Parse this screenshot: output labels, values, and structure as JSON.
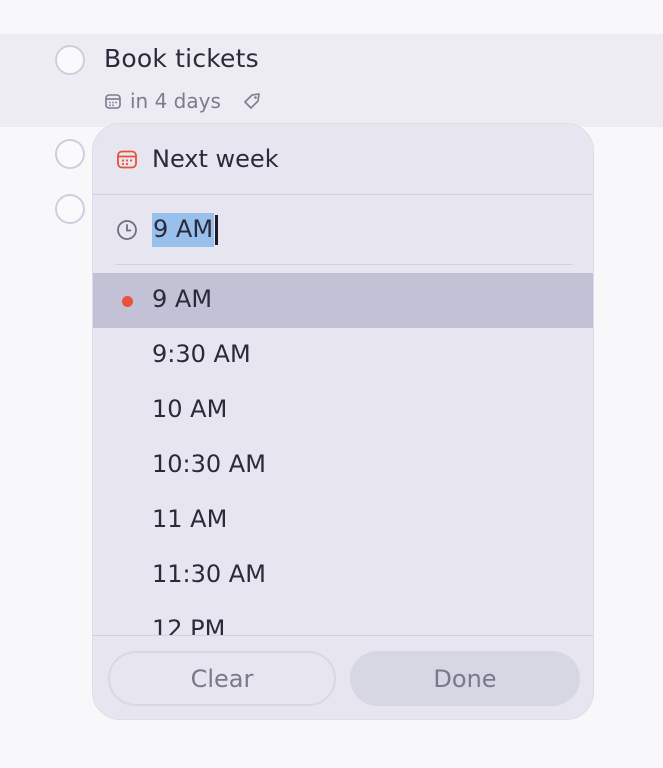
{
  "task": {
    "title": "Book tickets",
    "due": "in 4 days",
    "icons": {
      "due": "calendar-icon",
      "label": "tag-icon"
    }
  },
  "picker": {
    "date_label": "Next week",
    "date_icon": "calendar-icon",
    "date_icon_color": "#e8523b",
    "time_icon": "clock-icon",
    "time_input_value": "9 AM",
    "selected_time": "9 AM",
    "accent_color": "#e8523b",
    "selection_highlight": "#98c0ec",
    "options": [
      "9 AM",
      "9:30 AM",
      "10 AM",
      "10:30 AM",
      "11 AM",
      "11:30 AM",
      "12 PM"
    ],
    "clear_label": "Clear",
    "done_label": "Done"
  }
}
